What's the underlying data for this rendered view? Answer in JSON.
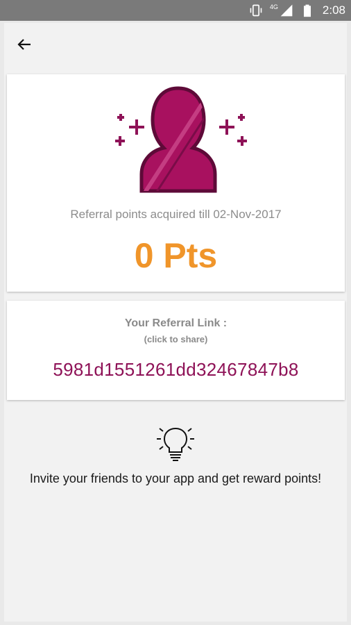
{
  "status_bar": {
    "network": "4G",
    "time": "2:08",
    "icons": [
      "vibrate-icon",
      "signal-icon",
      "battery-icon"
    ]
  },
  "toolbar": {
    "back_icon": "arrow-left-icon"
  },
  "points_card": {
    "avatar_icon": "user-avatar-sparkle-icon",
    "acquired_label": "Referral points acquired till 02-Nov-2017",
    "points": "0 Pts"
  },
  "referral_card": {
    "title": "Your Referral Link :",
    "subtitle": "(click to share)",
    "code": "5981d1551261dd32467847b8"
  },
  "invite": {
    "icon": "lightbulb-icon",
    "text": "Invite your friends to your app and get reward points!"
  },
  "colors": {
    "accent_orange": "#f0952a",
    "brand_magenta": "#8e1257",
    "status_bar": "#7a7a7a",
    "background": "#f2f2f2"
  }
}
